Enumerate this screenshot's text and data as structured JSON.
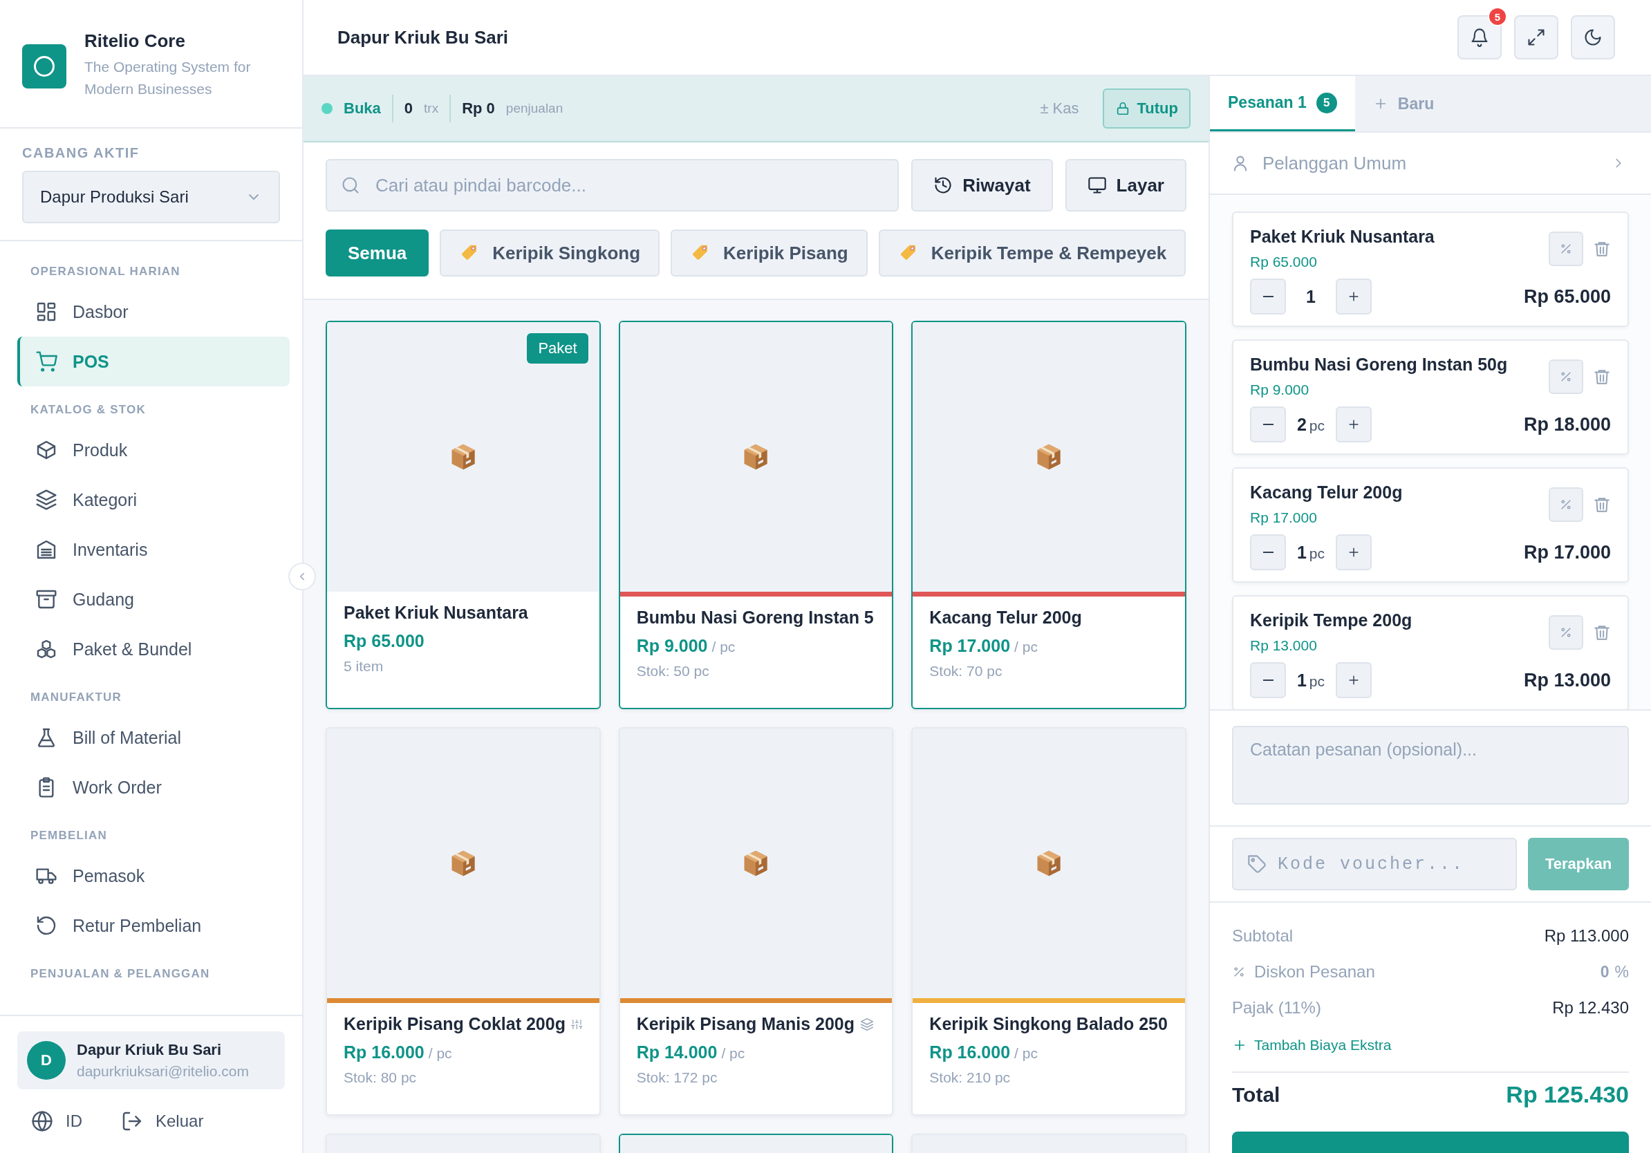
{
  "brand": {
    "title": "Ritelio Core",
    "subtitle": "The Operating System for Modern Businesses"
  },
  "branch": {
    "label": "CABANG AKTIF",
    "value": "Dapur Produksi Sari"
  },
  "nav": [
    {
      "heading": "OPERASIONAL HARIAN",
      "items": [
        {
          "label": "Dasbor",
          "selected": false
        },
        {
          "label": "POS",
          "selected": true
        }
      ]
    },
    {
      "heading": "KATALOG & STOK",
      "items": [
        {
          "label": "Produk",
          "selected": false
        },
        {
          "label": "Kategori",
          "selected": false
        },
        {
          "label": "Inventaris",
          "selected": false
        },
        {
          "label": "Gudang",
          "selected": false
        },
        {
          "label": "Paket & Bundel",
          "selected": false
        }
      ]
    },
    {
      "heading": "MANUFAKTUR",
      "items": [
        {
          "label": "Bill of Material",
          "selected": false
        },
        {
          "label": "Work Order",
          "selected": false
        }
      ]
    },
    {
      "heading": "PEMBELIAN",
      "items": [
        {
          "label": "Pemasok",
          "selected": false
        },
        {
          "label": "Retur Pembelian",
          "selected": false
        }
      ]
    },
    {
      "heading": "PENJUALAN & PELANGGAN"
    }
  ],
  "user": {
    "initial": "D",
    "name": "Dapur Kriuk Bu Sari",
    "email": "dapurkriuksari@ritelio.com"
  },
  "footer": {
    "language": "ID",
    "logout": "Keluar"
  },
  "header": {
    "title": "Dapur Kriuk Bu Sari",
    "notifications": "5"
  },
  "session": {
    "status": "Buka",
    "trx_count": "0",
    "trx_label": "trx",
    "sales": "Rp 0",
    "sales_label": "penjualan",
    "cash": "± Kas",
    "close": "Tutup"
  },
  "search": {
    "placeholder": "Cari atau pindai barcode..."
  },
  "actions": [
    "Riwayat",
    "Layar"
  ],
  "categories": [
    {
      "label": "Semua",
      "selected": true
    },
    {
      "label": "Keripik Singkong",
      "selected": false
    },
    {
      "label": "Keripik Pisang",
      "selected": false
    },
    {
      "label": "Keripik Tempe & Rempeyek",
      "selected": false
    }
  ],
  "products": [
    {
      "name": "Paket Kriuk Nusantara",
      "kind": "bundle",
      "badge": "Paket",
      "price": "Rp 65.000",
      "detail": "5 item",
      "in_cart": true
    },
    {
      "name": "Bumbu Nasi Goreng Instan 5",
      "kind": "simple",
      "price": "Rp 9.000",
      "unit": "/ pc",
      "detail": "Stok: 50 pc",
      "color": "#e05656",
      "in_cart": true
    },
    {
      "name": "Kacang Telur 200g",
      "kind": "simple",
      "price": "Rp 17.000",
      "unit": "/ pc",
      "detail": "Stok: 70 pc",
      "color": "#e05656",
      "in_cart": true
    },
    {
      "name": "Keripik Pisang Coklat 200g",
      "kind": "variant",
      "price": "Rp 16.000",
      "unit": "/ pc",
      "detail": "Stok: 80 pc",
      "color": "#dd8a35",
      "in_cart": false
    },
    {
      "name": "Keripik Pisang Manis 200g",
      "kind": "multi_unit",
      "price": "Rp 14.000",
      "unit": "/ pc",
      "detail": "Stok: 172 pc",
      "color": "#dd8a35",
      "in_cart": false
    },
    {
      "name": "Keripik Singkong Balado 250",
      "kind": "simple",
      "price": "Rp 16.000",
      "unit": "/ pc",
      "detail": "Stok: 210 pc",
      "color": "#f0b03f",
      "in_cart": false
    },
    {
      "kind": "partial",
      "in_cart": false
    },
    {
      "kind": "partial",
      "in_cart": true
    },
    {
      "kind": "partial",
      "in_cart": false
    }
  ],
  "order_tabs": [
    {
      "label": "Pesanan 1",
      "count": "5",
      "selected": true
    },
    {
      "label": "Baru",
      "selected": false
    }
  ],
  "customer": "Pelanggan Umum",
  "cart": [
    {
      "name": "Paket Kriuk Nusantara",
      "price": "Rp 65.000",
      "qty": "1",
      "total": "Rp 65.000"
    },
    {
      "name": "Bumbu Nasi Goreng Instan 50g",
      "price": "Rp 9.000",
      "qty": "2",
      "unit": "pc",
      "total": "Rp 18.000"
    },
    {
      "name": "Kacang Telur 200g",
      "price": "Rp 17.000",
      "qty": "1",
      "unit": "pc",
      "total": "Rp 17.000"
    },
    {
      "name": "Keripik Tempe 200g",
      "price": "Rp 13.000",
      "qty": "1",
      "unit": "pc",
      "total": "Rp 13.000"
    }
  ],
  "notes": {
    "placeholder": "Catatan pesanan (opsional)..."
  },
  "voucher": {
    "placeholder": "Kode voucher...",
    "button": "Terapkan",
    "disabled": true
  },
  "summary": {
    "subtotal_label": "Subtotal",
    "subtotal": "Rp 113.000",
    "discount_label": "Diskon Pesanan",
    "discount": "0",
    "discount_unit": "%",
    "tax_label": "Pajak (11%)",
    "tax": "Rp 12.430",
    "extra": "Tambah Biaya Ekstra",
    "total_label": "Total",
    "total": "Rp 125.430"
  }
}
